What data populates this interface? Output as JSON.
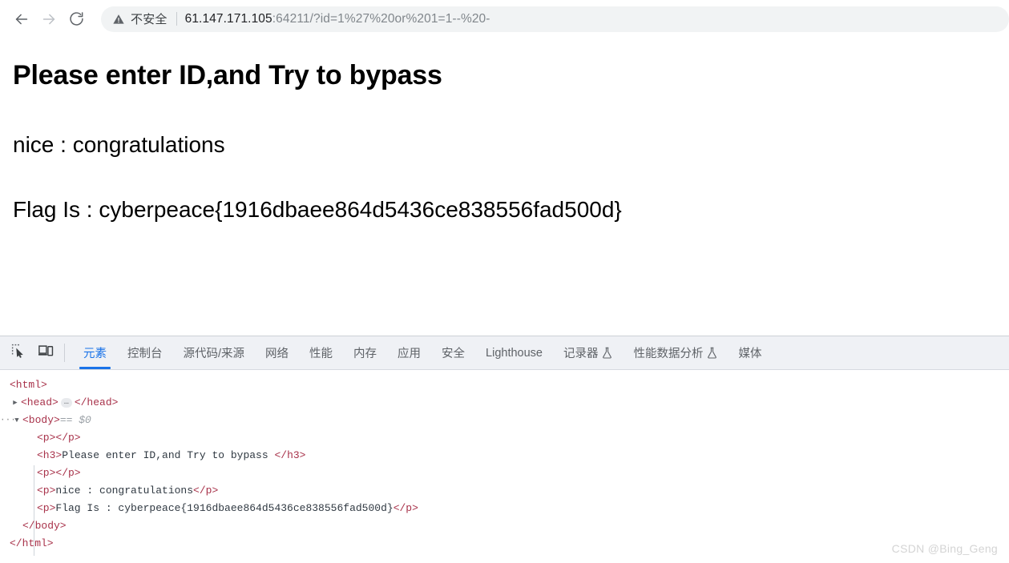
{
  "browser": {
    "back_icon": "arrow-left-icon",
    "forward_icon": "arrow-right-icon",
    "reload_icon": "reload-icon",
    "security_icon": "warning-triangle-icon",
    "security_label": "不安全",
    "url_host": "61.147.171.105",
    "url_port": ":64211",
    "url_path": "/?id=1%27%20or%201=1--%20-",
    "url_full": "61.147.171.105:64211/?id=1%27%20or%201=1--%20-"
  },
  "page": {
    "heading": "Please enter ID,and Try to bypass",
    "line_nice": "nice : congratulations",
    "line_flag": "Flag Is : cyberpeace{1916dbaee864d5436ce838556fad500d}"
  },
  "devtools": {
    "inspect_icon": "inspect-element-icon",
    "device_icon": "device-toolbar-icon",
    "tabs": [
      {
        "label": "元素",
        "active": true,
        "flask": false
      },
      {
        "label": "控制台",
        "active": false,
        "flask": false
      },
      {
        "label": "源代码/来源",
        "active": false,
        "flask": false
      },
      {
        "label": "网络",
        "active": false,
        "flask": false
      },
      {
        "label": "性能",
        "active": false,
        "flask": false
      },
      {
        "label": "内存",
        "active": false,
        "flask": false
      },
      {
        "label": "应用",
        "active": false,
        "flask": false
      },
      {
        "label": "安全",
        "active": false,
        "flask": false
      },
      {
        "label": "Lighthouse",
        "active": false,
        "flask": false
      },
      {
        "label": "记录器",
        "active": false,
        "flask": true
      },
      {
        "label": "性能数据分析",
        "active": false,
        "flask": true
      },
      {
        "label": "媒体",
        "active": false,
        "flask": false
      }
    ],
    "tree": {
      "html_open": "<html>",
      "head_open": "<head>",
      "head_close": "</head>",
      "head_collapsed": "…",
      "body_open": "<body>",
      "body_selected_marker": "== $0",
      "body_menu": "···",
      "body_triangle": "▼",
      "head_triangle": "▶",
      "p_empty_1": "<p></p>",
      "h3_line": "<h3>Please enter ID,and Try to bypass </h3>",
      "h3_open": "<h3>",
      "h3_text": "Please enter ID,and Try to bypass ",
      "h3_close": "</h3>",
      "p_empty_2": "<p></p>",
      "p_open": "<p>",
      "p_close": "</p>",
      "p_nice_text": "nice : congratulations",
      "p_flag_text": "Flag Is : cyberpeace{1916dbaee864d5436ce838556fad500d}",
      "body_close": "</body>",
      "html_close": "</html>"
    }
  },
  "watermark": "CSDN @Bing_Geng",
  "colors": {
    "accent": "#1a73e8",
    "tag": "#a8324a",
    "text": "#303942",
    "omnibox_bg": "#f1f3f4",
    "tabbar_bg": "#eff1f5"
  }
}
